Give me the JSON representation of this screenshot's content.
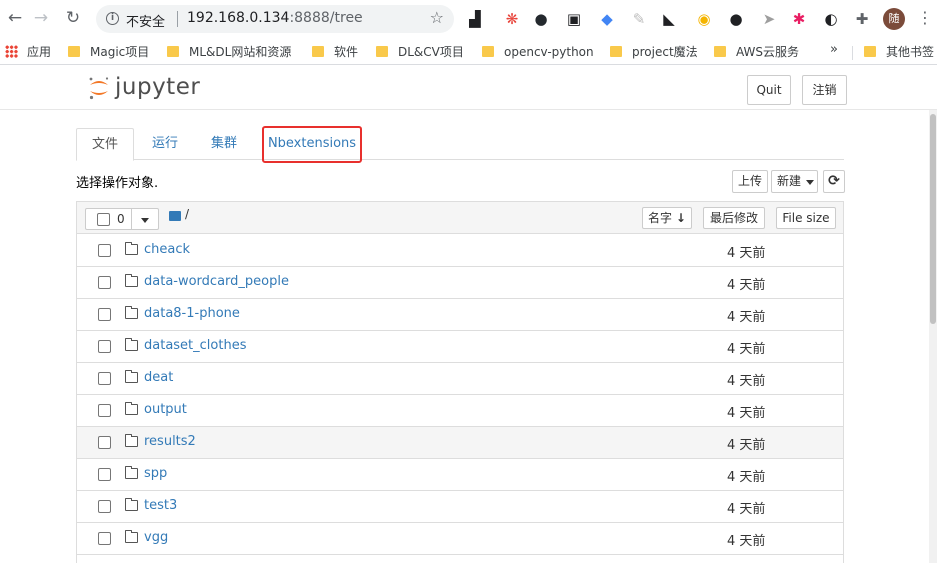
{
  "browser": {
    "back_glyph": "←",
    "forward_glyph": "→",
    "reload_glyph": "↻",
    "security_label": "不安全",
    "url_host": "192.168.0.134",
    "url_rest": ":8888/tree",
    "star_glyph": "☆",
    "profile_initial": "随",
    "menu_glyph": "⋮",
    "extensions": [
      {
        "icon": "ext-puzzle-stand-icon",
        "color": "#202124",
        "glyph": "▟"
      },
      {
        "icon": "ext-network-icon",
        "color": "#e8453c",
        "glyph": "❋"
      },
      {
        "icon": "github-icon",
        "color": "#24292e",
        "glyph": "●"
      },
      {
        "icon": "ext-mask-icon",
        "color": "#202124",
        "glyph": "▣"
      },
      {
        "icon": "ext-diamond-icon",
        "color": "#4285f4",
        "glyph": "◆"
      },
      {
        "icon": "ext-feather-icon",
        "color": "#bdbdbd",
        "glyph": "✎"
      },
      {
        "icon": "ext-cat-icon",
        "color": "#202124",
        "glyph": "◣"
      },
      {
        "icon": "ext-shield-icon",
        "color": "#f4b400",
        "glyph": "◉"
      },
      {
        "icon": "ext-moon-icon",
        "color": "#202124",
        "glyph": "●"
      },
      {
        "icon": "ext-cursor-icon",
        "color": "#9e9e9e",
        "glyph": "➤"
      },
      {
        "icon": "ext-pinwheel-icon",
        "color": "#e91e63",
        "glyph": "✱"
      },
      {
        "icon": "ext-circle-icon",
        "color": "#202124",
        "glyph": "◐"
      },
      {
        "icon": "extensions-puzzle-icon",
        "color": "#5f6368",
        "glyph": "✚"
      }
    ]
  },
  "bookmarks": {
    "apps_label": "应用",
    "items": [
      "Magic项目",
      "ML&DL网站和资源",
      "软件",
      "DL&CV项目",
      "opencv-python",
      "project魔法",
      "AWS云服务"
    ],
    "more_glyph": "»",
    "other_label": "其他书签"
  },
  "jupyter": {
    "logo_text": "jupyter",
    "quit_label": "Quit",
    "logout_label": "注销"
  },
  "tabs": [
    {
      "label": "文件",
      "active": true
    },
    {
      "label": "运行",
      "active": false
    },
    {
      "label": "集群",
      "active": false
    },
    {
      "label": "Nbextensions",
      "active": false
    }
  ],
  "toolbar": {
    "select_hint": "选择操作对象.",
    "upload_label": "上传",
    "new_label": "新建",
    "refresh_glyph": "⟳"
  },
  "list_header": {
    "selected_count": "0",
    "breadcrumb_path": "/",
    "sort_name_label": "名字",
    "sort_name_arrow": "↓",
    "sort_modified_label": "最后修改",
    "sort_size_label": "File size"
  },
  "files": [
    {
      "name": "cheack",
      "modified": "4 天前"
    },
    {
      "name": "data-wordcard_people",
      "modified": "4 天前"
    },
    {
      "name": "data8-1-phone",
      "modified": "4 天前"
    },
    {
      "name": "dataset_clothes",
      "modified": "4 天前"
    },
    {
      "name": "deat",
      "modified": "4 天前"
    },
    {
      "name": "output",
      "modified": "4 天前"
    },
    {
      "name": "results2",
      "modified": "4 天前"
    },
    {
      "name": "spp",
      "modified": "4 天前"
    },
    {
      "name": "test3",
      "modified": "4 天前"
    },
    {
      "name": "vgg",
      "modified": "4 天前"
    }
  ],
  "colors": {
    "link": "#337ab7",
    "highlight_box": "#e8302d",
    "folder_bookmark": "#f9c94b",
    "logo_orange": "#f37726"
  }
}
